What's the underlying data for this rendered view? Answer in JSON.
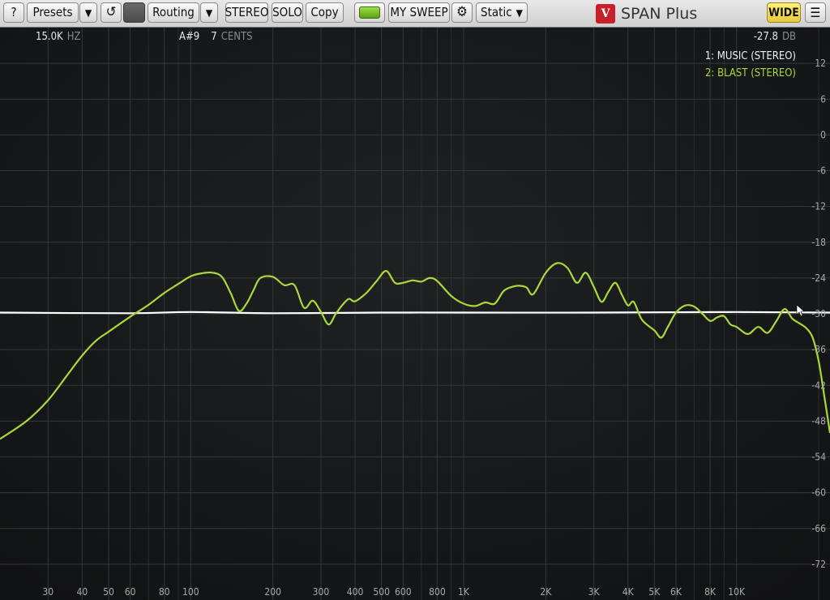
{
  "toolbar": {
    "help_label": "?",
    "presets_label": "Presets",
    "routing_label": "Routing",
    "stereo_label": "STEREO",
    "solo_label": "SOLO",
    "copy_label": "Copy",
    "sweep_label": "MY SWEEP",
    "mode_label": "Static",
    "wide_label": "WIDE",
    "app_title": "SPAN Plus",
    "logo_letters": "V",
    "dropdown_glyph": "▼",
    "refresh_glyph": "↺",
    "gear_glyph": "⚙",
    "menu_glyph": "☰",
    "colors": {
      "wide": "#f2dc52",
      "led": "#7cc42c"
    }
  },
  "readouts": {
    "freq_value": "15.0K",
    "freq_unit": "HZ",
    "note": "A#9",
    "cents_value": "7",
    "cents_unit": "CENTS",
    "level_value": "-27.8",
    "level_unit": "DB"
  },
  "legend": {
    "items": [
      {
        "label": "1: MUSIC (STEREO)",
        "color": "#ffffff"
      },
      {
        "label": "2: BLAST (STEREO)",
        "color": "#a8d83a"
      }
    ]
  },
  "chart_data": {
    "type": "line",
    "x_scale": "log",
    "xlim": [
      20,
      22000
    ],
    "ylim": [
      -78,
      18
    ],
    "x_ticks": [
      30,
      40,
      50,
      60,
      80,
      100,
      200,
      300,
      400,
      500,
      600,
      800,
      1000,
      2000,
      3000,
      4000,
      5000,
      6000,
      8000,
      10000
    ],
    "x_tick_labels": [
      "30",
      "40",
      "50",
      "60",
      "80",
      "100",
      "200",
      "300",
      "400",
      "500",
      "600",
      "800",
      "1K",
      "2K",
      "3K",
      "4K",
      "5K",
      "6K",
      "8K",
      "10K"
    ],
    "y_ticks": [
      12,
      6,
      0,
      -6,
      -12,
      -18,
      -24,
      -30,
      -36,
      -42,
      -48,
      -54,
      -60,
      -66,
      -72
    ],
    "y_tick_labels": [
      "12",
      "6",
      "0",
      "-6",
      "-12",
      "-18",
      "-24",
      "-30",
      "-36",
      "-42",
      "-48",
      "-54",
      "-60",
      "-66",
      "-72"
    ],
    "grid": true,
    "series": [
      {
        "name": "1: MUSIC (STEREO)",
        "color": "#ffffff",
        "x": [
          20,
          60,
          100,
          200,
          500,
          1000,
          3000,
          10000,
          22000
        ],
        "y": [
          -29.8,
          -29.9,
          -29.7,
          -29.9,
          -29.8,
          -29.8,
          -29.8,
          -29.7,
          -29.8
        ]
      },
      {
        "name": "2: BLAST (STEREO)",
        "color": "#a8d83a",
        "x": [
          20,
          25,
          30,
          35,
          40,
          45,
          50,
          60,
          70,
          80,
          90,
          100,
          110,
          120,
          130,
          140,
          150,
          160,
          170,
          180,
          200,
          220,
          240,
          260,
          280,
          300,
          320,
          340,
          360,
          380,
          400,
          440,
          480,
          520,
          560,
          600,
          650,
          700,
          750,
          800,
          900,
          1000,
          1100,
          1200,
          1300,
          1400,
          1500,
          1600,
          1700,
          1800,
          2000,
          2200,
          2400,
          2600,
          2800,
          3000,
          3200,
          3400,
          3600,
          3800,
          4000,
          4200,
          4500,
          5000,
          5300,
          5600,
          6000,
          6500,
          7000,
          7500,
          8000,
          8500,
          9000,
          9500,
          10000,
          11000,
          12000,
          13000,
          14000,
          15000,
          16000,
          17000,
          18000,
          19000,
          20000,
          21000,
          22000
        ],
        "y": [
          -51,
          -48,
          -44.5,
          -40.5,
          -37,
          -34.5,
          -33,
          -30.5,
          -28.5,
          -26.5,
          -25,
          -23.7,
          -23.2,
          -23.1,
          -23.8,
          -26.5,
          -29.5,
          -28.3,
          -26,
          -24,
          -23.8,
          -25.2,
          -25.2,
          -29,
          -27.8,
          -29.7,
          -31.8,
          -30,
          -28.5,
          -27.5,
          -27.9,
          -26.5,
          -24.5,
          -22.8,
          -24.8,
          -24.8,
          -24.4,
          -24.6,
          -24,
          -24.5,
          -27,
          -28.3,
          -28.7,
          -28.1,
          -28.3,
          -26.2,
          -25.5,
          -25.3,
          -25.6,
          -26.7,
          -23.1,
          -21.5,
          -22.3,
          -24.8,
          -23.1,
          -25.5,
          -28,
          -26.2,
          -24.8,
          -26.8,
          -28.6,
          -28,
          -31,
          -32.8,
          -34,
          -32.2,
          -29.8,
          -28.6,
          -28.8,
          -30,
          -31.2,
          -30.6,
          -30.4,
          -31.8,
          -32.2,
          -33.4,
          -32.2,
          -33.2,
          -31.2,
          -29.2,
          -30.8,
          -31.6,
          -32.4,
          -34,
          -38,
          -44,
          -50
        ]
      }
    ]
  }
}
